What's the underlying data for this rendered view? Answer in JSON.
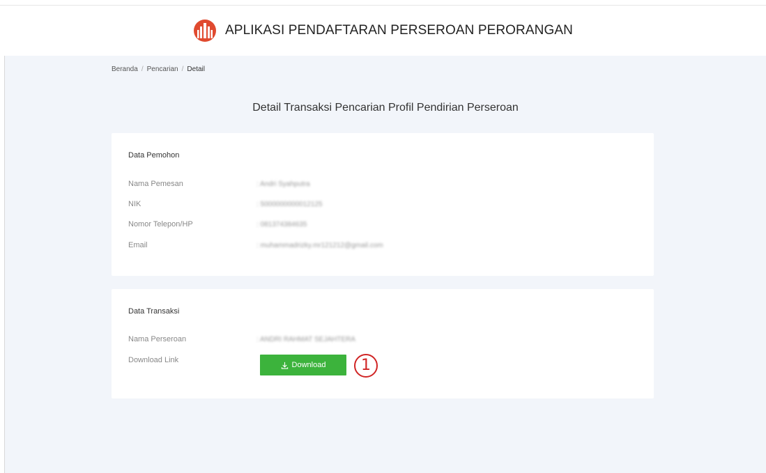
{
  "header": {
    "title": "APLIKASI PENDAFTARAN PERSEROAN PERORANGAN",
    "logo_icon": "building-logo-icon",
    "logo_color": "#e04a2f"
  },
  "breadcrumb": {
    "items": [
      "Beranda",
      "Pencarian",
      "Detail"
    ],
    "separator": "/"
  },
  "page": {
    "title": "Detail Transaksi Pencarian Profil Pendirian Perseroan"
  },
  "data_pemohon": {
    "title": "Data Pemohon",
    "rows": [
      {
        "label": "Nama Pemesan",
        "value": ": Andri Syahputra"
      },
      {
        "label": "NIK",
        "value": ": 5000000000012125"
      },
      {
        "label": "Nomor Telepon/HP",
        "value": ": 081374384635"
      },
      {
        "label": "Email",
        "value": ": muhammadrizky.mr121212@gmail.com"
      }
    ]
  },
  "data_transaksi": {
    "title": "Data Transaksi",
    "rows": [
      {
        "label": "Nama Perseroan",
        "value": ": ANDRI RAHMAT SEJAHTERA"
      },
      {
        "label": "Download Link"
      }
    ],
    "download_label": "Download",
    "download_icon": "download-icon",
    "button_color": "#3cb33c"
  },
  "annotation": {
    "marker": "1",
    "color": "#d02424"
  }
}
